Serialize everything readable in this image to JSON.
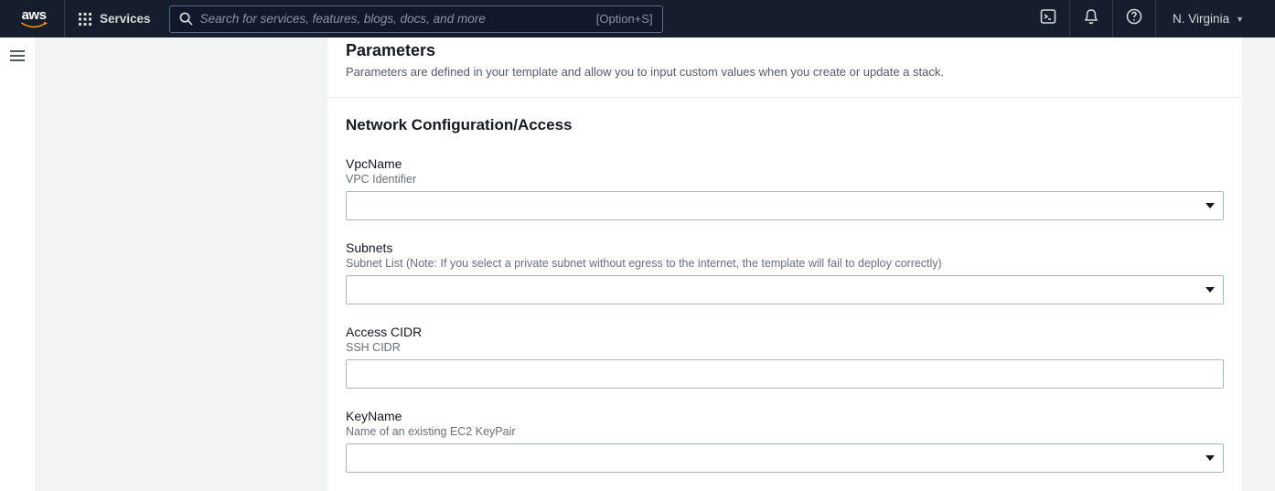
{
  "nav": {
    "logo_text": "aws",
    "services_label": "Services",
    "search_placeholder": "Search for services, features, blogs, docs, and more",
    "search_hint": "[Option+S]",
    "region_label": "N. Virginia"
  },
  "panel": {
    "title": "Parameters",
    "description": "Parameters are defined in your template and allow you to input custom values when you create or update a stack."
  },
  "section": {
    "title": "Network Configuration/Access",
    "fields": {
      "vpc": {
        "label": "VpcName",
        "desc": "VPC Identifier",
        "value": ""
      },
      "subnets": {
        "label": "Subnets",
        "desc": "Subnet List (Note: If you select a private subnet without egress to the internet, the template will fail to deploy correctly)",
        "value": ""
      },
      "cidr": {
        "label": "Access CIDR",
        "desc": "SSH CIDR",
        "value": ""
      },
      "keyname": {
        "label": "KeyName",
        "desc": "Name of an existing EC2 KeyPair",
        "value": ""
      }
    }
  }
}
